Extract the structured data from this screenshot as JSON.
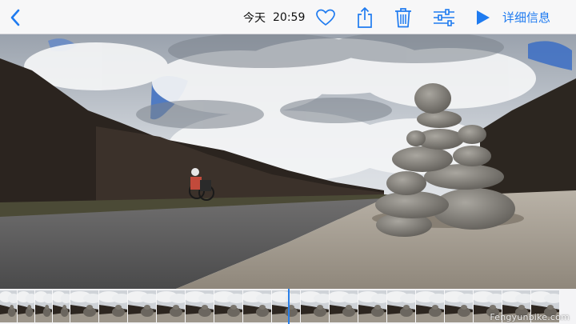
{
  "toolbar": {
    "back_icon": "chevron-left-icon",
    "date_label": "今天",
    "time_label": "20:59",
    "favorite_icon": "heart-icon",
    "share_icon": "share-icon",
    "delete_icon": "trash-icon",
    "edit_icon": "sliders-icon",
    "play_icon": "play-icon",
    "details_label": "详细信息"
  },
  "colors": {
    "accent": "#1f7bf0",
    "toolbar_bg": "#f7f7f8",
    "playhead": "#2a7fe8"
  },
  "media": {
    "description_icon": "video-frame",
    "subject": "stacked-stones-cairn"
  },
  "scrubber": {
    "frame_count": 23,
    "playhead_progress": 0.5
  },
  "watermark": {
    "text": "Fengyunbike.com"
  }
}
